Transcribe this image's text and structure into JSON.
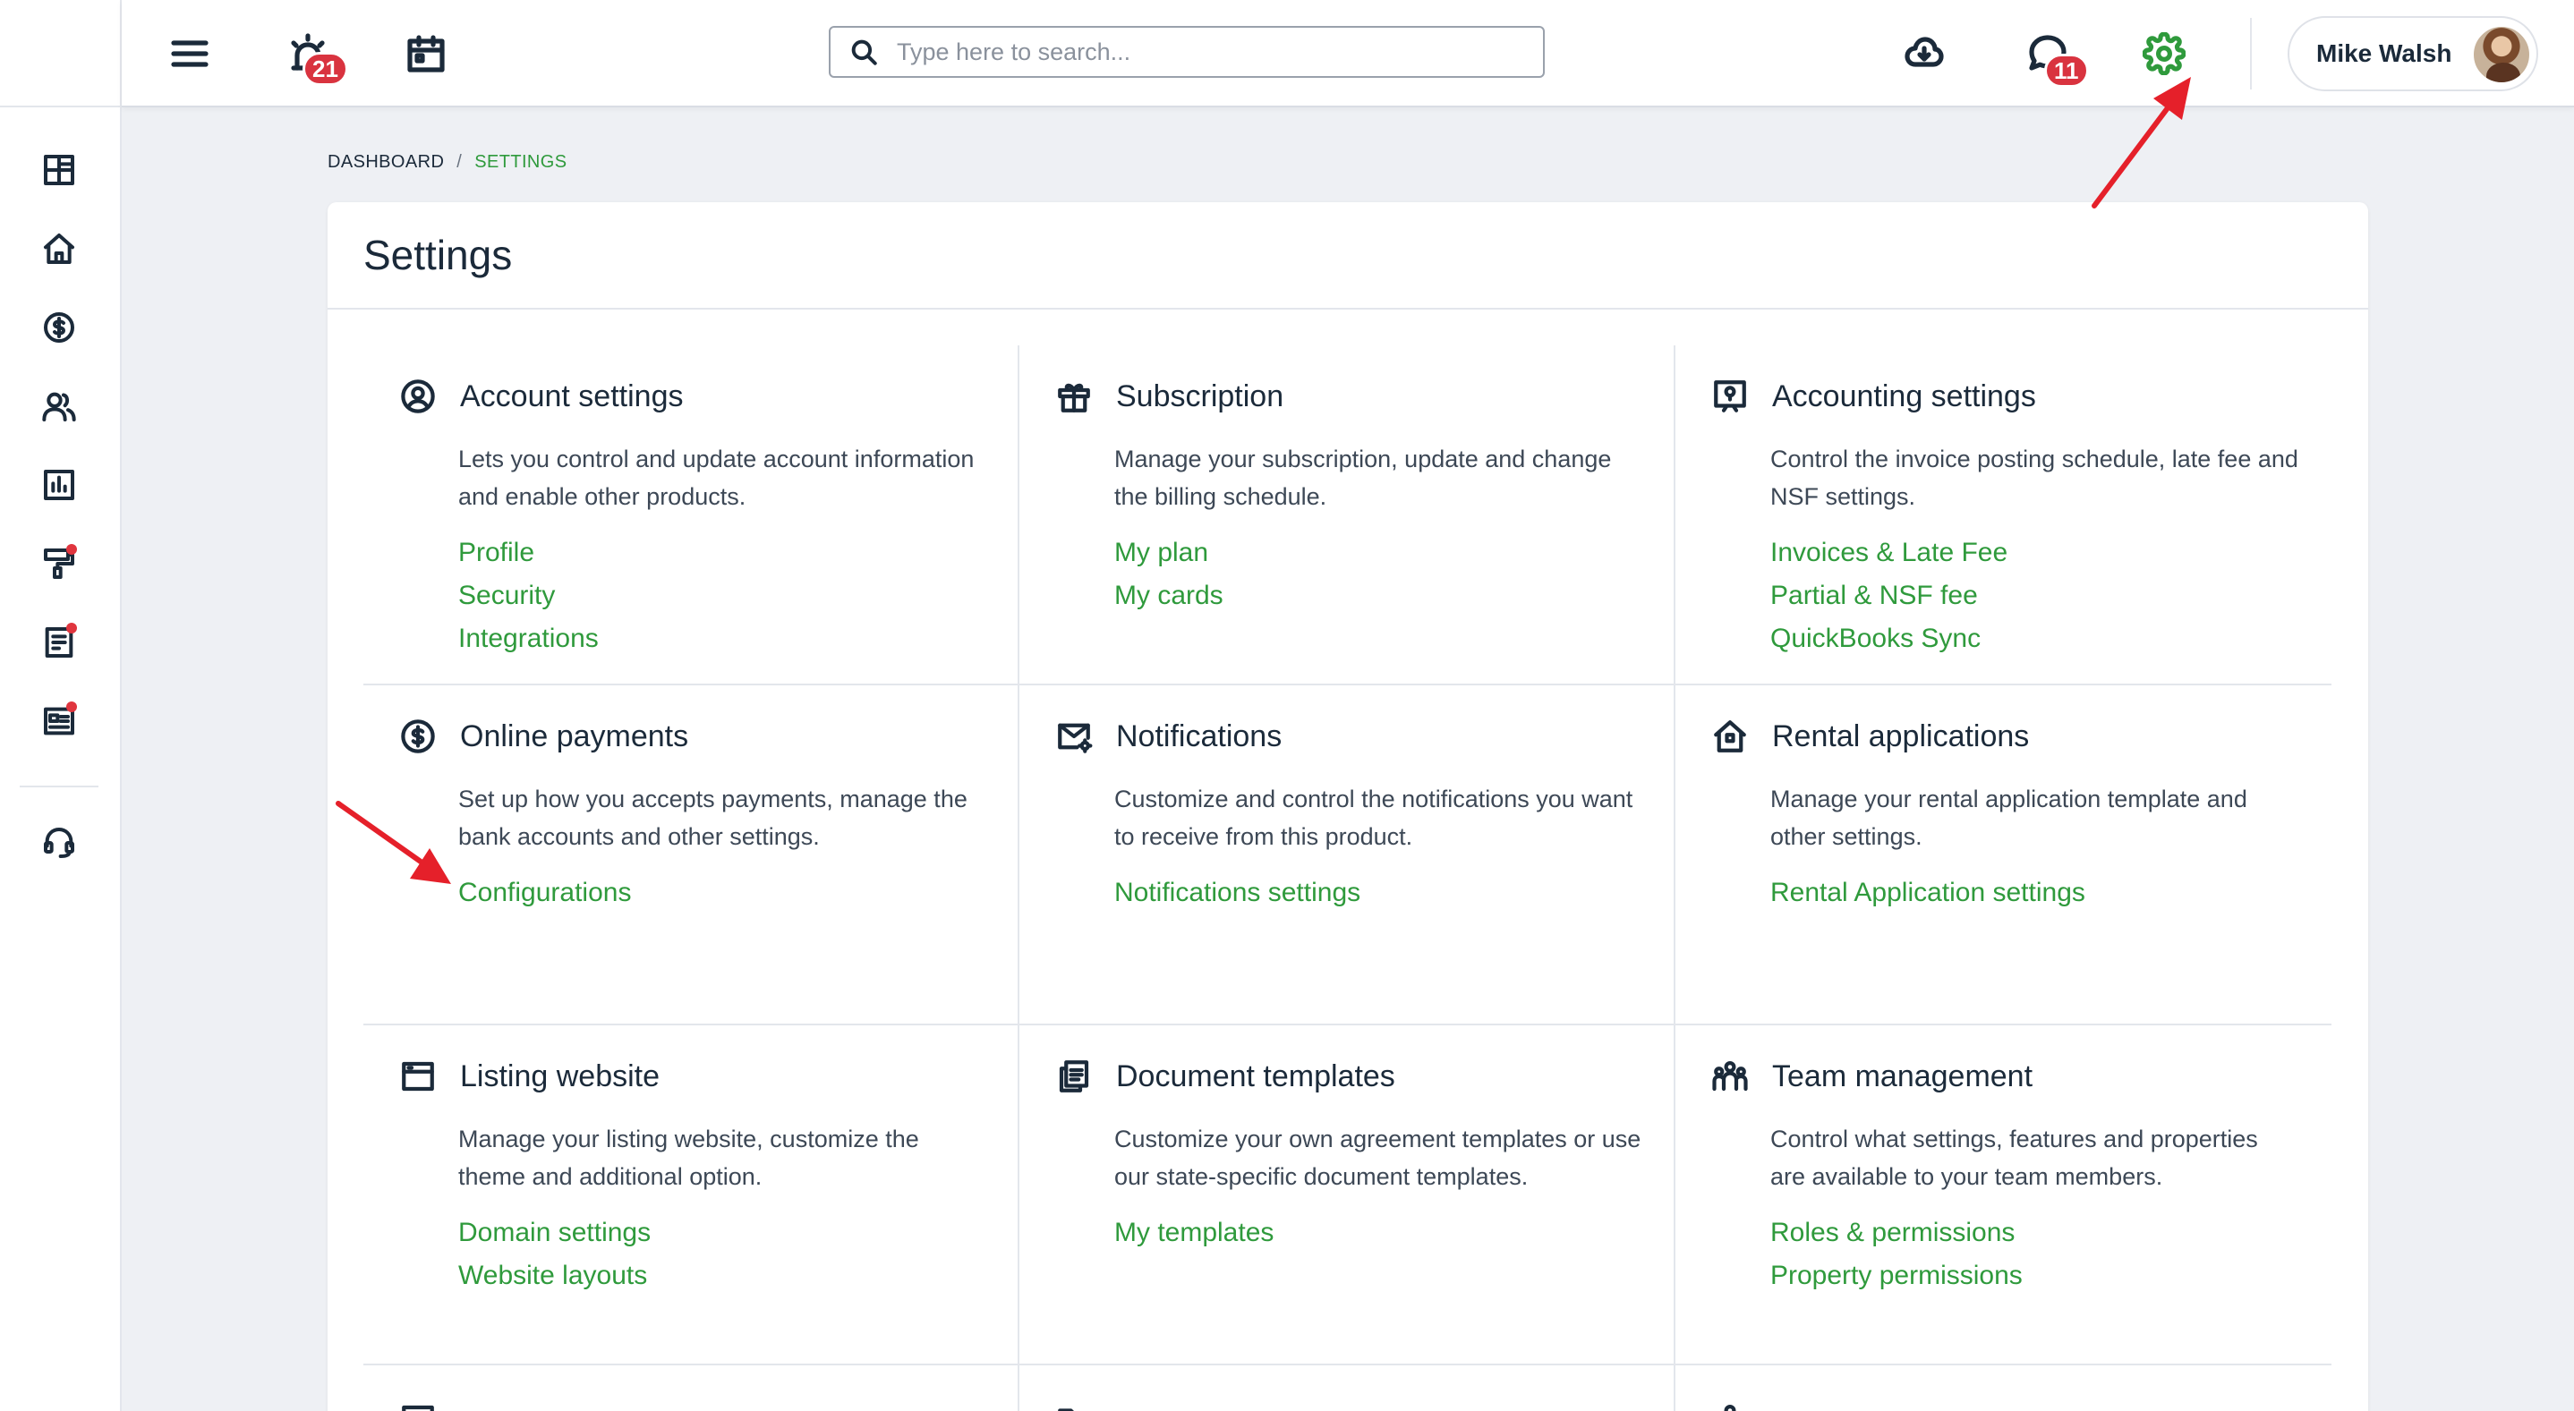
{
  "header": {
    "alerts_badge": "21",
    "messages_badge": "11",
    "search_placeholder": "Type here to search...",
    "user_name": "Mike Walsh"
  },
  "breadcrumb": {
    "root": "DASHBOARD",
    "separator": "/",
    "current": "SETTINGS"
  },
  "page": {
    "title": "Settings"
  },
  "sections": [
    {
      "icon": "user-circle-icon",
      "title": "Account settings",
      "desc": "Lets you control and update account information and enable other products.",
      "links": [
        "Profile",
        "Security",
        "Integrations"
      ]
    },
    {
      "icon": "gift-icon",
      "title": "Subscription",
      "desc": "Manage your subscription, update and change the billing schedule.",
      "links": [
        "My plan",
        "My cards"
      ]
    },
    {
      "icon": "accounting-icon",
      "title": "Accounting settings",
      "desc": "Control the invoice posting schedule, late fee and NSF settings.",
      "links": [
        "Invoices & Late Fee",
        "Partial & NSF fee",
        "QuickBooks Sync"
      ]
    },
    {
      "icon": "dollar-circle-icon",
      "title": "Online payments",
      "desc": "Set up how you accepts payments, manage the bank accounts and other settings.",
      "links": [
        "Configurations"
      ]
    },
    {
      "icon": "mail-gear-icon",
      "title": "Notifications",
      "desc": "Customize and control the notifications you want to receive from this product.",
      "links": [
        "Notifications settings"
      ]
    },
    {
      "icon": "house-icon",
      "title": "Rental applications",
      "desc": "Manage your rental application template and other settings.",
      "links": [
        "Rental Application settings"
      ]
    },
    {
      "icon": "browser-window-icon",
      "title": "Listing website",
      "desc": "Manage your listing website, customize the theme and additional option.",
      "links": [
        "Domain settings",
        "Website layouts"
      ]
    },
    {
      "icon": "documents-icon",
      "title": "Document templates",
      "desc": "Customize your own agreement templates or use our state-specific document templates.",
      "links": [
        "My templates"
      ]
    },
    {
      "icon": "team-icon",
      "title": "Team management",
      "desc": "Control what settings, features and properties are available to your team members.",
      "links": [
        "Roles & permissions",
        "Property permissions"
      ]
    }
  ],
  "colors": {
    "accent_green": "#2f9a3c",
    "badge_red": "#d9333f",
    "annotation_arrow": "#e5202a"
  }
}
